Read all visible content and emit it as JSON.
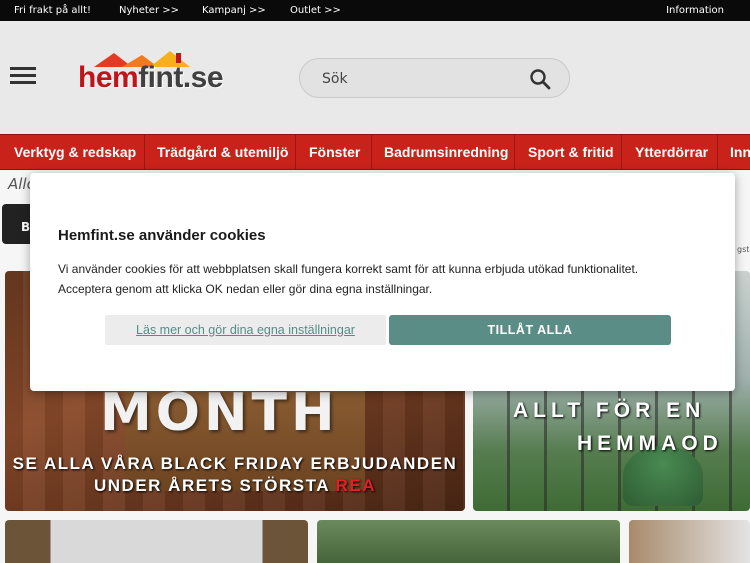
{
  "topbar": {
    "links": [
      "Fri frakt på allt!",
      "Nyheter >>",
      "Kampanj >>",
      "Outlet >>"
    ],
    "right_link": "Information"
  },
  "header": {
    "logo": {
      "part1": "hem",
      "part2": "fint.se"
    },
    "search": {
      "placeholder": "Sök"
    }
  },
  "nav": {
    "categories": [
      "Verktyg & redskap",
      "Trädgård & utemiljö",
      "Fönster",
      "Badrumsinredning",
      "Sport & fritid",
      "Ytterdörrar",
      "Inn"
    ]
  },
  "page": {
    "breadcrumb_partial": "Allo",
    "dark_button_label": "B",
    "right_peek_text": "gsta"
  },
  "banners": {
    "black_friday": {
      "big_text": "MONTH",
      "line1": "SE ALLA VÅRA BLACK FRIDAY ERBJUDANDEN",
      "line2_prefix": "UNDER ÅRETS STÖRSTA",
      "line2_highlight": "REA"
    },
    "garden": {
      "line1": "ALLT FÖR EN",
      "line2": "HEMMAOD"
    }
  },
  "cookie_dialog": {
    "title": "Hemfint.se använder cookies",
    "text_line1": "Vi använder cookies för att webbplatsen skall fungera korrekt samt för att kunna erbjuda utökad funktionalitet.",
    "text_line2": "Acceptera genom att klicka OK nedan eller gör dina egna inställningar.",
    "more_button": "Läs mer och gör dina egna inställningar",
    "allow_button": "TILLÅT ALLA"
  },
  "colors": {
    "nav_red": "#c8221b",
    "brand_red": "#c0141b",
    "allow_green": "#5a8d86"
  }
}
